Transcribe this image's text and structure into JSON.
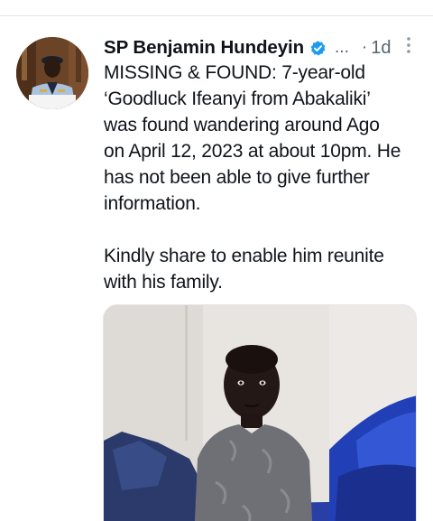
{
  "tweet": {
    "author_name": "SP Benjamin Hundeyin",
    "name_overflow": "...",
    "separator": "·",
    "timestamp": "1d",
    "text_lines": [
      "MISSING & FOUND: 7-year-old",
      "‘Goodluck Ifeanyi from Abakaliki’",
      "was found wandering around Ago",
      "on April 12, 2023 at about 10pm. He",
      "has not been able to give further",
      "information.",
      "",
      "Kindly share to enable him reunite",
      "with his family."
    ]
  },
  "icons": {
    "verified": "verified-badge-icon",
    "more": "more-options-icon"
  },
  "colors": {
    "verified_badge": "#1d9bf0",
    "text_primary": "#0f1419",
    "text_secondary": "#536471"
  }
}
